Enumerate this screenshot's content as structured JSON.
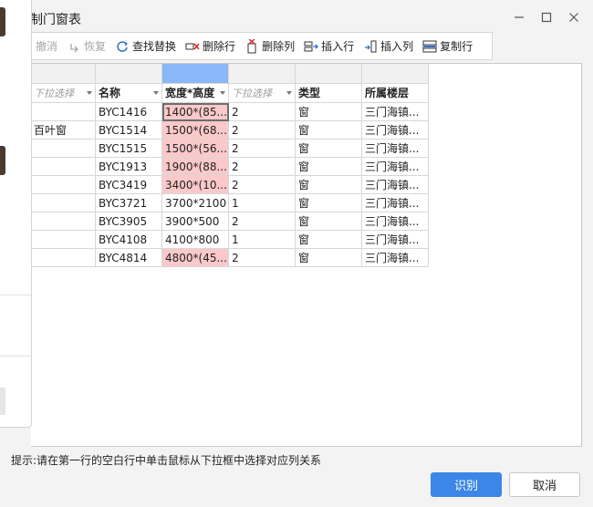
{
  "dialog": {
    "title": "制门窗表"
  },
  "toolbar": {
    "undo": "撤消",
    "redo": "恢复",
    "find": "查找替换",
    "delete_row": "删除行",
    "delete_col": "删除列",
    "insert_row": "插入行",
    "insert_col": "插入列",
    "copy_row": "复制行"
  },
  "mapping_row": [
    "下拉选择",
    "名称",
    "宽度*高度",
    "下拉选择",
    "类型",
    "所属楼层"
  ],
  "rows": [
    [
      "",
      "BYC1416",
      "1400*(85...",
      "2",
      "窗",
      "三门海镇..."
    ],
    [
      "百叶窗",
      "BYC1514",
      "1500*(68...",
      "2",
      "窗",
      "三门海镇..."
    ],
    [
      "",
      "BYC1515",
      "1500*(56...",
      "2",
      "窗",
      "三门海镇..."
    ],
    [
      "",
      "BYC1913",
      "1900*(88...",
      "2",
      "窗",
      "三门海镇..."
    ],
    [
      "",
      "BYC3419",
      "3400*(10...",
      "2",
      "窗",
      "三门海镇..."
    ],
    [
      "",
      "BYC3721",
      "3700*2100",
      "1",
      "窗",
      "三门海镇..."
    ],
    [
      "",
      "BYC3905",
      "3900*500",
      "2",
      "窗",
      "三门海镇..."
    ],
    [
      "",
      "BYC4108",
      "4100*800",
      "1",
      "窗",
      "三门海镇..."
    ],
    [
      "",
      "BYC4814",
      "4800*(45...",
      "2",
      "窗",
      "三门海镇..."
    ]
  ],
  "hint": "提示:请在第一行的空白行中单击鼠标从下拉框中选择对应列关系",
  "buttons": {
    "recognize": "识别",
    "cancel": "取消"
  }
}
